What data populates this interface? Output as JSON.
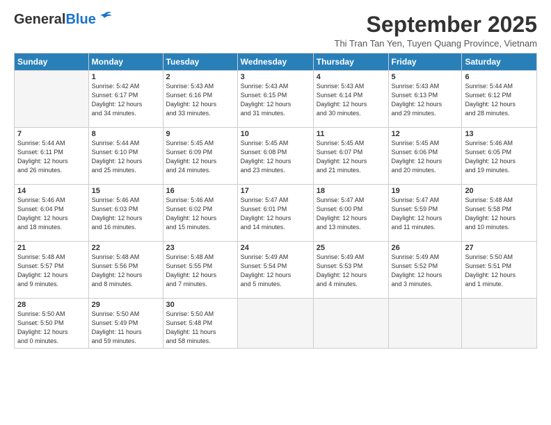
{
  "header": {
    "logo_line1": "General",
    "logo_line2": "Blue",
    "month_title": "September 2025",
    "subtitle": "Thi Tran Tan Yen, Tuyen Quang Province, Vietnam"
  },
  "weekdays": [
    "Sunday",
    "Monday",
    "Tuesday",
    "Wednesday",
    "Thursday",
    "Friday",
    "Saturday"
  ],
  "weeks": [
    [
      {
        "day": "",
        "info": ""
      },
      {
        "day": "1",
        "info": "Sunrise: 5:42 AM\nSunset: 6:17 PM\nDaylight: 12 hours\nand 34 minutes."
      },
      {
        "day": "2",
        "info": "Sunrise: 5:43 AM\nSunset: 6:16 PM\nDaylight: 12 hours\nand 33 minutes."
      },
      {
        "day": "3",
        "info": "Sunrise: 5:43 AM\nSunset: 6:15 PM\nDaylight: 12 hours\nand 31 minutes."
      },
      {
        "day": "4",
        "info": "Sunrise: 5:43 AM\nSunset: 6:14 PM\nDaylight: 12 hours\nand 30 minutes."
      },
      {
        "day": "5",
        "info": "Sunrise: 5:43 AM\nSunset: 6:13 PM\nDaylight: 12 hours\nand 29 minutes."
      },
      {
        "day": "6",
        "info": "Sunrise: 5:44 AM\nSunset: 6:12 PM\nDaylight: 12 hours\nand 28 minutes."
      }
    ],
    [
      {
        "day": "7",
        "info": "Sunrise: 5:44 AM\nSunset: 6:11 PM\nDaylight: 12 hours\nand 26 minutes."
      },
      {
        "day": "8",
        "info": "Sunrise: 5:44 AM\nSunset: 6:10 PM\nDaylight: 12 hours\nand 25 minutes."
      },
      {
        "day": "9",
        "info": "Sunrise: 5:45 AM\nSunset: 6:09 PM\nDaylight: 12 hours\nand 24 minutes."
      },
      {
        "day": "10",
        "info": "Sunrise: 5:45 AM\nSunset: 6:08 PM\nDaylight: 12 hours\nand 23 minutes."
      },
      {
        "day": "11",
        "info": "Sunrise: 5:45 AM\nSunset: 6:07 PM\nDaylight: 12 hours\nand 21 minutes."
      },
      {
        "day": "12",
        "info": "Sunrise: 5:45 AM\nSunset: 6:06 PM\nDaylight: 12 hours\nand 20 minutes."
      },
      {
        "day": "13",
        "info": "Sunrise: 5:46 AM\nSunset: 6:05 PM\nDaylight: 12 hours\nand 19 minutes."
      }
    ],
    [
      {
        "day": "14",
        "info": "Sunrise: 5:46 AM\nSunset: 6:04 PM\nDaylight: 12 hours\nand 18 minutes."
      },
      {
        "day": "15",
        "info": "Sunrise: 5:46 AM\nSunset: 6:03 PM\nDaylight: 12 hours\nand 16 minutes."
      },
      {
        "day": "16",
        "info": "Sunrise: 5:46 AM\nSunset: 6:02 PM\nDaylight: 12 hours\nand 15 minutes."
      },
      {
        "day": "17",
        "info": "Sunrise: 5:47 AM\nSunset: 6:01 PM\nDaylight: 12 hours\nand 14 minutes."
      },
      {
        "day": "18",
        "info": "Sunrise: 5:47 AM\nSunset: 6:00 PM\nDaylight: 12 hours\nand 13 minutes."
      },
      {
        "day": "19",
        "info": "Sunrise: 5:47 AM\nSunset: 5:59 PM\nDaylight: 12 hours\nand 11 minutes."
      },
      {
        "day": "20",
        "info": "Sunrise: 5:48 AM\nSunset: 5:58 PM\nDaylight: 12 hours\nand 10 minutes."
      }
    ],
    [
      {
        "day": "21",
        "info": "Sunrise: 5:48 AM\nSunset: 5:57 PM\nDaylight: 12 hours\nand 9 minutes."
      },
      {
        "day": "22",
        "info": "Sunrise: 5:48 AM\nSunset: 5:56 PM\nDaylight: 12 hours\nand 8 minutes."
      },
      {
        "day": "23",
        "info": "Sunrise: 5:48 AM\nSunset: 5:55 PM\nDaylight: 12 hours\nand 7 minutes."
      },
      {
        "day": "24",
        "info": "Sunrise: 5:49 AM\nSunset: 5:54 PM\nDaylight: 12 hours\nand 5 minutes."
      },
      {
        "day": "25",
        "info": "Sunrise: 5:49 AM\nSunset: 5:53 PM\nDaylight: 12 hours\nand 4 minutes."
      },
      {
        "day": "26",
        "info": "Sunrise: 5:49 AM\nSunset: 5:52 PM\nDaylight: 12 hours\nand 3 minutes."
      },
      {
        "day": "27",
        "info": "Sunrise: 5:50 AM\nSunset: 5:51 PM\nDaylight: 12 hours\nand 1 minute."
      }
    ],
    [
      {
        "day": "28",
        "info": "Sunrise: 5:50 AM\nSunset: 5:50 PM\nDaylight: 12 hours\nand 0 minutes."
      },
      {
        "day": "29",
        "info": "Sunrise: 5:50 AM\nSunset: 5:49 PM\nDaylight: 11 hours\nand 59 minutes."
      },
      {
        "day": "30",
        "info": "Sunrise: 5:50 AM\nSunset: 5:48 PM\nDaylight: 11 hours\nand 58 minutes."
      },
      {
        "day": "",
        "info": ""
      },
      {
        "day": "",
        "info": ""
      },
      {
        "day": "",
        "info": ""
      },
      {
        "day": "",
        "info": ""
      }
    ]
  ]
}
